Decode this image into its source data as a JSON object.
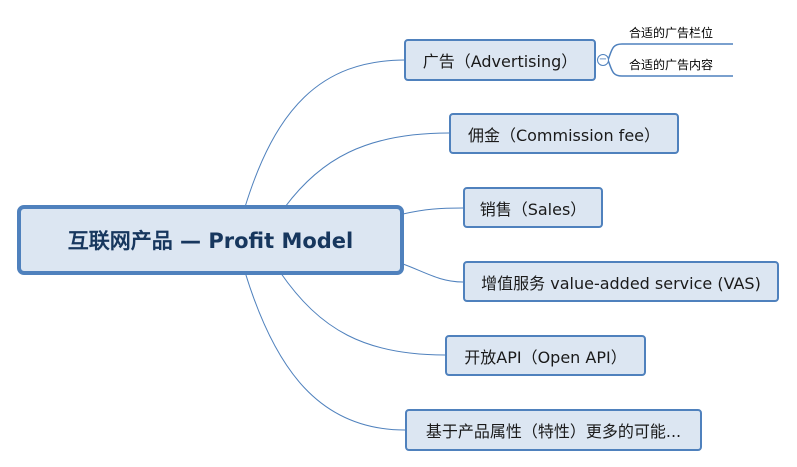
{
  "root": {
    "label": "互联网产品 — Profit Model"
  },
  "branches": [
    {
      "label": "广告（Advertising）"
    },
    {
      "label": "佣金（Commission fee）"
    },
    {
      "label": "销售（Sales）"
    },
    {
      "label": "增值服务 value-added service (VAS)"
    },
    {
      "label": "开放API（Open API）"
    },
    {
      "label": "基于产品属性（特性）更多的可能..."
    }
  ],
  "advertising_children": [
    {
      "label": "合适的广告栏位"
    },
    {
      "label": "合适的广告内容"
    }
  ],
  "collapse_symbol": "−",
  "colors": {
    "node_fill": "#dce6f2",
    "node_border": "#4f81bd",
    "connector": "#4f81bd",
    "root_text": "#17375e"
  }
}
